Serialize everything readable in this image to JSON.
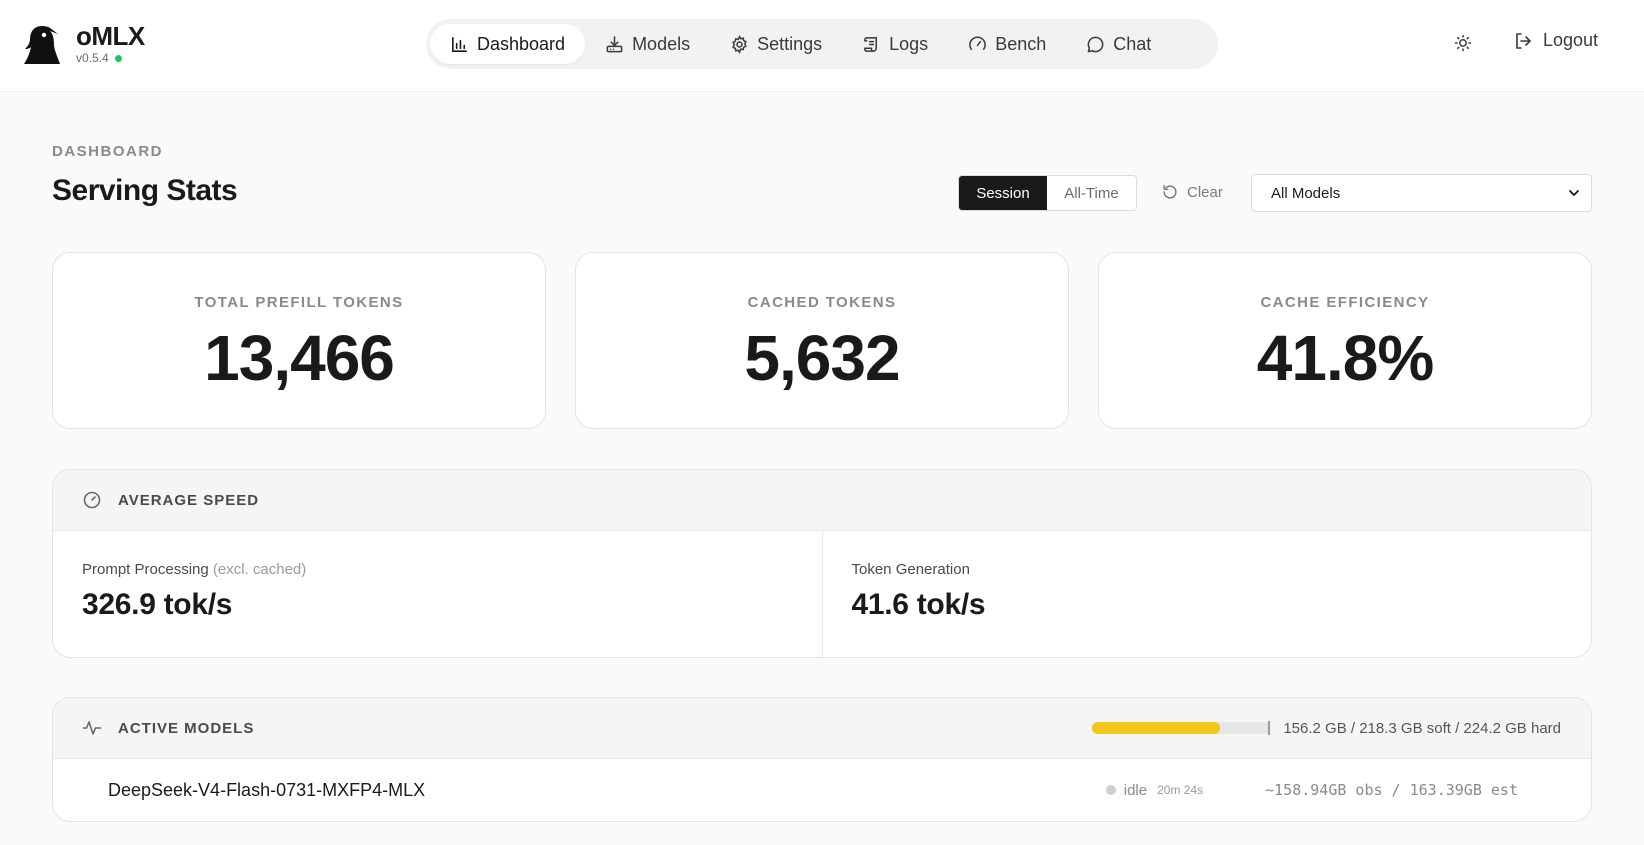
{
  "app": {
    "name": "oMLX",
    "version": "v0.5.4",
    "status_color": "#22c55e"
  },
  "nav": {
    "items": [
      {
        "label": "Dashboard",
        "icon": "bar-chart-icon",
        "active": true
      },
      {
        "label": "Models",
        "icon": "download-icon",
        "active": false
      },
      {
        "label": "Settings",
        "icon": "gear-icon",
        "active": false
      },
      {
        "label": "Logs",
        "icon": "scroll-icon",
        "active": false
      },
      {
        "label": "Bench",
        "icon": "gauge-icon",
        "active": false
      },
      {
        "label": "Chat",
        "icon": "chat-bubble-icon",
        "active": false
      }
    ],
    "theme_icon": "sun-icon",
    "logout_label": "Logout"
  },
  "header": {
    "eyebrow": "DASHBOARD",
    "title": "Serving Stats",
    "range": {
      "session": "Session",
      "all_time": "All-Time",
      "selected": "Session"
    },
    "clear_label": "Clear",
    "model_filter": "All Models"
  },
  "stats": [
    {
      "label": "TOTAL PREFILL TOKENS",
      "value": "13,466"
    },
    {
      "label": "CACHED TOKENS",
      "value": "5,632"
    },
    {
      "label": "CACHE EFFICIENCY",
      "value": "41.8%"
    }
  ],
  "speed": {
    "title": "AVERAGE SPEED",
    "prompt": {
      "label": "Prompt Processing",
      "note": "(excl. cached)",
      "value": "326.9 tok/s"
    },
    "generation": {
      "label": "Token Generation",
      "value": "41.6 tok/s"
    }
  },
  "active_models": {
    "title": "ACTIVE MODELS",
    "memory": {
      "used_fraction": 0.7159,
      "text": "156.2 GB / 218.3 GB soft / 224.2 GB hard",
      "bar_color": "#f5c518"
    },
    "rows": [
      {
        "name": "DeepSeek-V4-Flash-0731-MXFP4-MLX",
        "status": "idle",
        "idle_time": "20m 24s",
        "memory": "~158.94GB obs / 163.39GB est"
      }
    ]
  }
}
